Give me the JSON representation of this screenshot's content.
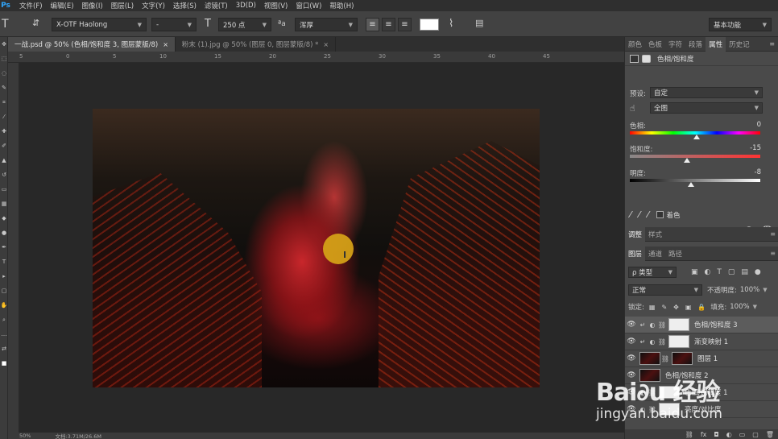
{
  "menu": {
    "logo": "Ps",
    "items": [
      "文件(F)",
      "编辑(E)",
      "图像(I)",
      "图层(L)",
      "文字(Y)",
      "选择(S)",
      "滤镜(T)",
      "3D(D)",
      "视图(V)",
      "窗口(W)",
      "帮助(H)"
    ]
  },
  "options": {
    "font_family": "X-OTF Haolong",
    "font_style": "-",
    "font_size": "250 点",
    "aa_label": "ªa",
    "aa_mode": "浑厚",
    "workspace": "基本功能"
  },
  "doc_tabs": [
    {
      "title": "一战.psd @ 50% (色相/饱和度 3, 图层蒙版/8)",
      "close": "×"
    },
    {
      "title": "粉末 (1).jpg @ 50% (图层 0, 图层蒙版/8) *",
      "close": "×"
    }
  ],
  "ruler_ticks": [
    "5",
    "0",
    "5",
    "10",
    "15",
    "20",
    "25",
    "30",
    "35",
    "40",
    "45"
  ],
  "status": {
    "zoom": "50%",
    "doc": "文档:3.71M/26.6M"
  },
  "panel_tabs": [
    "颜色",
    "色板",
    "字符",
    "段落",
    "属性",
    "历史记"
  ],
  "properties": {
    "title": "色相/饱和度",
    "preset_label": "预设:",
    "preset_value": "自定",
    "channel_value": "全图",
    "hue_label": "色相:",
    "hue_value": "0",
    "sat_label": "饱和度:",
    "sat_value": "-15",
    "light_label": "明度:",
    "light_value": "-8",
    "colorize_label": "着色"
  },
  "adjust_tabs": [
    "调整",
    "样式"
  ],
  "layers_tabs": [
    "图层",
    "通道",
    "路径"
  ],
  "layers": {
    "filter_kind": "ρ 类型",
    "blend_mode": "正常",
    "opacity_label": "不透明度:",
    "opacity_value": "100%",
    "lock_label": "锁定:",
    "fill_label": "填充:",
    "fill_value": "100%",
    "items": [
      {
        "name": "色相/饱和度 3",
        "selected": true
      },
      {
        "name": "渐变映射 1",
        "selected": false
      },
      {
        "name": "图层 1",
        "selected": false
      },
      {
        "name": "色相/饱和度 2",
        "selected": false
      },
      {
        "name": "色相/饱和度 1",
        "selected": false
      },
      {
        "name": "亮度/对比度",
        "selected": false
      }
    ]
  },
  "watermark": {
    "logo": "Bai∂u 经验",
    "url": "jingyan.baidu.com"
  }
}
